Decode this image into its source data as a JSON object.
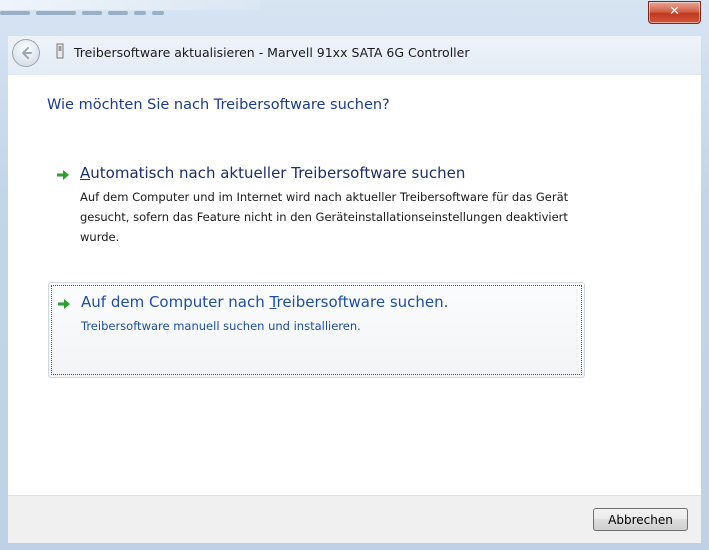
{
  "window": {
    "close_label": "✕",
    "title": "Treibersoftware aktualisieren - Marvell 91xx SATA 6G Controller"
  },
  "icons": {
    "back": "back-arrow-icon",
    "device": "device-icon",
    "option_arrow": "green-arrow-icon"
  },
  "colors": {
    "heading": "#1c3b8c",
    "link": "#1e4ea8",
    "arrow": "#2e9e2e",
    "close": "#c0391f"
  },
  "main": {
    "heading": "Wie möchten Sie nach Treibersoftware suchen?",
    "options": [
      {
        "title_access_key": "A",
        "title_rest": "utomatisch nach aktueller Treibersoftware suchen",
        "description": "Auf dem Computer und im Internet wird nach aktueller Treibersoftware für das Gerät gesucht, sofern das Feature nicht in den Geräteinstallationseinstellungen deaktiviert wurde."
      },
      {
        "title_pre": "Auf dem Computer nach ",
        "title_access_key": "T",
        "title_post": "reibersoftware suchen.",
        "description": "Treibersoftware manuell suchen und installieren."
      }
    ]
  },
  "footer": {
    "cancel_label": "Abbrechen"
  }
}
